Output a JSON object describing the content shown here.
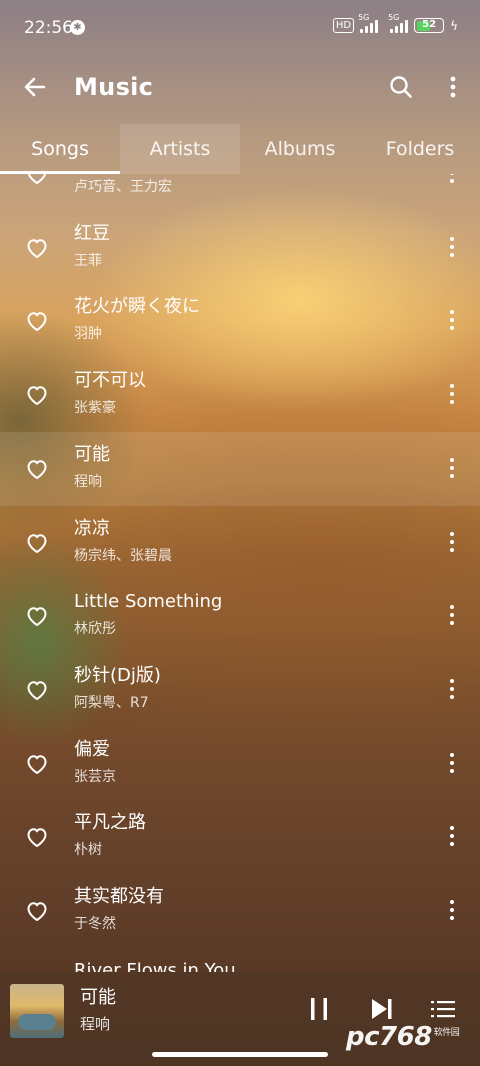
{
  "status_bar": {
    "time": "22:56",
    "hd_label": "HD",
    "net1": "5G",
    "net2": "5G",
    "battery": "52"
  },
  "app_bar": {
    "title": "Music"
  },
  "tabs": [
    {
      "label": "Songs"
    },
    {
      "label": "Artists"
    },
    {
      "label": "Albums"
    },
    {
      "label": "Folders"
    }
  ],
  "songs": [
    {
      "title": "",
      "artist": "卢巧音、王力宏"
    },
    {
      "title": "红豆",
      "artist": "王菲"
    },
    {
      "title": "花火が瞬く夜に",
      "artist": "羽肿"
    },
    {
      "title": "可不可以",
      "artist": "张紫豪"
    },
    {
      "title": "可能",
      "artist": "程响"
    },
    {
      "title": "凉凉",
      "artist": "杨宗纬、张碧晨"
    },
    {
      "title": "Little Something",
      "artist": "林欣彤"
    },
    {
      "title": "秒针(Dj版)",
      "artist": "阿梨粤、R7"
    },
    {
      "title": "偏爱",
      "artist": "张芸京"
    },
    {
      "title": "平凡之路",
      "artist": "朴树"
    },
    {
      "title": "其实都没有",
      "artist": "于冬然"
    },
    {
      "title": "River Flows in You",
      "artist": ""
    }
  ],
  "now_playing": {
    "title": "可能",
    "artist": "程响"
  },
  "watermark": {
    "text": "pc768",
    "sub": "软件园"
  }
}
